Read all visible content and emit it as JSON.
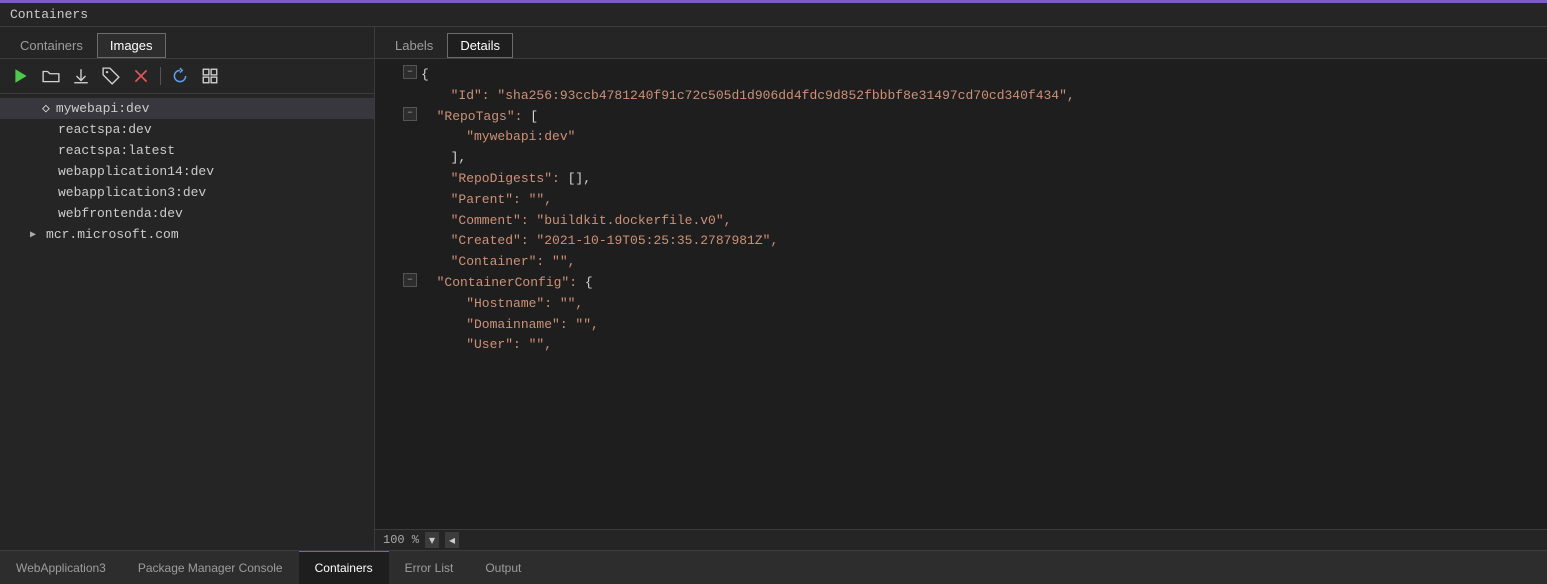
{
  "topAccent": true,
  "titleBar": {
    "label": "Containers"
  },
  "leftPanel": {
    "tabs": [
      {
        "id": "containers",
        "label": "Containers",
        "active": false
      },
      {
        "id": "images",
        "label": "Images",
        "active": true
      }
    ],
    "toolbar": {
      "buttons": [
        {
          "id": "run",
          "icon": "play",
          "label": "Run"
        },
        {
          "id": "open-folder",
          "icon": "folder",
          "label": "Open Folder"
        },
        {
          "id": "pull",
          "icon": "download",
          "label": "Pull"
        },
        {
          "id": "tag",
          "icon": "tag",
          "label": "Tag"
        },
        {
          "id": "delete",
          "icon": "delete",
          "label": "Delete"
        },
        {
          "id": "refresh",
          "icon": "refresh",
          "label": "Refresh"
        },
        {
          "id": "more",
          "icon": "more",
          "label": "More"
        }
      ]
    },
    "imageList": [
      {
        "id": 1,
        "name": "mywebapi:dev",
        "selected": true,
        "hasIcon": true,
        "indentLevel": 1
      },
      {
        "id": 2,
        "name": "reactspa:dev",
        "selected": false,
        "hasIcon": false,
        "indentLevel": 2
      },
      {
        "id": 3,
        "name": "reactspa:latest",
        "selected": false,
        "hasIcon": false,
        "indentLevel": 2
      },
      {
        "id": 4,
        "name": "webapplication14:dev",
        "selected": false,
        "hasIcon": false,
        "indentLevel": 2
      },
      {
        "id": 5,
        "name": "webapplication3:dev",
        "selected": false,
        "hasIcon": false,
        "indentLevel": 2
      },
      {
        "id": 6,
        "name": "webfrontenda:dev",
        "selected": false,
        "hasIcon": false,
        "indentLevel": 2
      },
      {
        "id": 7,
        "name": "mcr.microsoft.com",
        "selected": false,
        "hasIcon": false,
        "indentLevel": 2,
        "expandable": true
      }
    ]
  },
  "rightPanel": {
    "tabs": [
      {
        "id": "labels",
        "label": "Labels",
        "active": false
      },
      {
        "id": "details",
        "label": "Details",
        "active": true
      }
    ],
    "jsonLines": [
      {
        "id": 1,
        "indent": 0,
        "collapsible": true,
        "collapsed": false,
        "text": "{",
        "type": "bracket"
      },
      {
        "id": 2,
        "indent": 1,
        "collapsible": false,
        "text": "\"Id\": \"sha256:93ccb4781240f91c72c505d1d906dd4fdc9d852fbbbf8e31497cd70cd340f434\",",
        "keyPart": "\"Id\":",
        "valuePart": " \"sha256:93ccb4781240f91c72c505d1d906dd4fdc9d852fbbbf8e31497cd70cd340f434\","
      },
      {
        "id": 3,
        "indent": 1,
        "collapsible": true,
        "collapsed": false,
        "text": "\"RepoTags\": [",
        "keyPart": "\"RepoTags\":",
        "valuePart": " ["
      },
      {
        "id": 4,
        "indent": 2,
        "collapsible": false,
        "text": "\"mywebapi:dev\"",
        "valuePart": "\"mywebapi:dev\""
      },
      {
        "id": 5,
        "indent": 1,
        "collapsible": false,
        "text": "],",
        "type": "bracket-close"
      },
      {
        "id": 6,
        "indent": 1,
        "collapsible": false,
        "text": "\"RepoDigests\": [],",
        "keyPart": "\"RepoDigests\":",
        "valuePart": " [],"
      },
      {
        "id": 7,
        "indent": 1,
        "collapsible": false,
        "text": "\"Parent\": \"\",",
        "keyPart": "\"Parent\":",
        "valuePart": " \"\","
      },
      {
        "id": 8,
        "indent": 1,
        "collapsible": false,
        "text": "\"Comment\": \"buildkit.dockerfile.v0\",",
        "keyPart": "\"Comment\":",
        "valuePart": " \"buildkit.dockerfile.v0\","
      },
      {
        "id": 9,
        "indent": 1,
        "collapsible": false,
        "text": "\"Created\": \"2021-10-19T05:25:35.2787981Z\",",
        "keyPart": "\"Created\":",
        "valuePart": " \"2021-10-19T05:25:35.2787981Z\","
      },
      {
        "id": 10,
        "indent": 1,
        "collapsible": false,
        "text": "\"Container\": \"\",",
        "keyPart": "\"Container\":",
        "valuePart": " \"\","
      },
      {
        "id": 11,
        "indent": 1,
        "collapsible": true,
        "collapsed": false,
        "text": "\"ContainerConfig\": {",
        "keyPart": "\"ContainerConfig\":",
        "valuePart": " {"
      },
      {
        "id": 12,
        "indent": 2,
        "collapsible": false,
        "text": "\"Hostname\": \"\",",
        "keyPart": "\"Hostname\":",
        "valuePart": " \"\","
      },
      {
        "id": 13,
        "indent": 2,
        "collapsible": false,
        "text": "\"Domainname\": \"\",",
        "keyPart": "\"Domainname\":",
        "valuePart": " \"\","
      },
      {
        "id": 14,
        "indent": 2,
        "collapsible": false,
        "text": "\"User\": \"\",",
        "keyPart": "\"User\":",
        "valuePart": " \"\","
      }
    ],
    "zoomLevel": "100 %"
  },
  "bottomTabs": [
    {
      "id": "webapplication3",
      "label": "WebApplication3",
      "active": false
    },
    {
      "id": "package-manager-console",
      "label": "Package Manager Console",
      "active": false
    },
    {
      "id": "containers",
      "label": "Containers",
      "active": true
    },
    {
      "id": "error-list",
      "label": "Error List",
      "active": false
    },
    {
      "id": "output",
      "label": "Output",
      "active": false
    }
  ]
}
